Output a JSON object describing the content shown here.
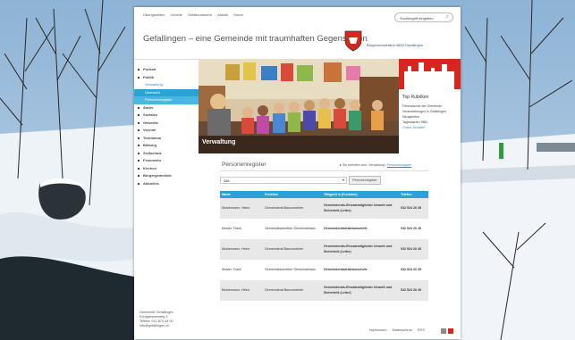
{
  "header": {
    "topnav": [
      "Übungsseiten",
      "Vorteile",
      "Gefallnummern",
      "Aktuell",
      "Home"
    ],
    "search_placeholder": "Suchbegriff eingeben",
    "site_title": "Gefallingen – eine Gemeinde mit traumhaften Gegensätzen",
    "crest_text": "Bürgermeisteramt 4863 Gefallingen"
  },
  "sidebar": {
    "items": [
      {
        "label": "Portrait",
        "kind": "b"
      },
      {
        "label": "Politik",
        "kind": "b"
      },
      {
        "label": "Verwaltung",
        "kind": "sub"
      },
      {
        "label": "Übersicht",
        "kind": "active"
      },
      {
        "label": "Personenregister",
        "kind": "active2"
      },
      {
        "label": "Ämter",
        "kind": "b"
      },
      {
        "label": "Soziales",
        "kind": "b"
      },
      {
        "label": "Gewerbe",
        "kind": "b"
      },
      {
        "label": "Vereine",
        "kind": "b"
      },
      {
        "label": "Tourismus",
        "kind": "b"
      },
      {
        "label": "Bildung",
        "kind": "b"
      },
      {
        "label": "Zivilschutz",
        "kind": "b"
      },
      {
        "label": "Feuerwehr",
        "kind": "b"
      },
      {
        "label": "Kirchen",
        "kind": "b"
      },
      {
        "label": "Bürgergemeinde",
        "kind": "b"
      },
      {
        "label": "Aktuelles",
        "kind": "b"
      }
    ],
    "address": [
      "Gemeinde Gefallingen",
      "Königsbrunnweg 3",
      "Telefon 012 874 44 00",
      "info@gefallingen.ch"
    ]
  },
  "hero": {
    "label": "Verwaltung"
  },
  "top_rubriken": {
    "title": "Top Rubriken",
    "links": [
      "Fitnesskurse der Gemeinde",
      "Veranstaltungen in Gefallingen",
      "Neuigkeiten",
      "Tageskarten SBB"
    ],
    "more": "Online-Schalter"
  },
  "main": {
    "title": "Personenregister",
    "crumb_prefix": "Sie befinden sich: Verwaltung /",
    "crumb_link": "Personenregister",
    "filter_value": "Alle",
    "filter_button": "Personenregister",
    "table": {
      "headers": [
        "Name",
        "Funktion",
        "Tätigkeit in (Funktion)",
        "Telefon"
      ],
      "rows": [
        [
          "Mustermann, Heinz",
          "Gemeinderat Bauvorsteher",
          "Gemeinderats-Einsatzmitglieder Umwelt und Sicherheit (Leiter)",
          "032 524 26 45"
        ],
        [
          "Muster, Frank",
          "Gemeindeschreiber Gemeindehaus",
          "Gemeinderatsfraktionschefs",
          "032 524 26 45"
        ],
        [
          "Mustermann, Heinz",
          "Gemeinderat Bauvorsteher",
          "Gemeinderats-Einsatzmitglieder Umwelt und Sicherheit (Leiter)",
          "032 524 26 45"
        ],
        [
          "Muster, Frank",
          "Gemeindeschreiber Gemeindehaus",
          "Gemeinderatsfraktionschefs",
          "032 524 26 45"
        ],
        [
          "Mustermann, Heinz",
          "Gemeinderat Bauvorsteher",
          "Gemeinderats-Einsatzmitglieder Umwelt und Sicherheit (Leiter)",
          "032 524 26 45"
        ]
      ]
    }
  },
  "footer": {
    "links": [
      "Impressum",
      "Datenschutz",
      "RSS"
    ]
  }
}
